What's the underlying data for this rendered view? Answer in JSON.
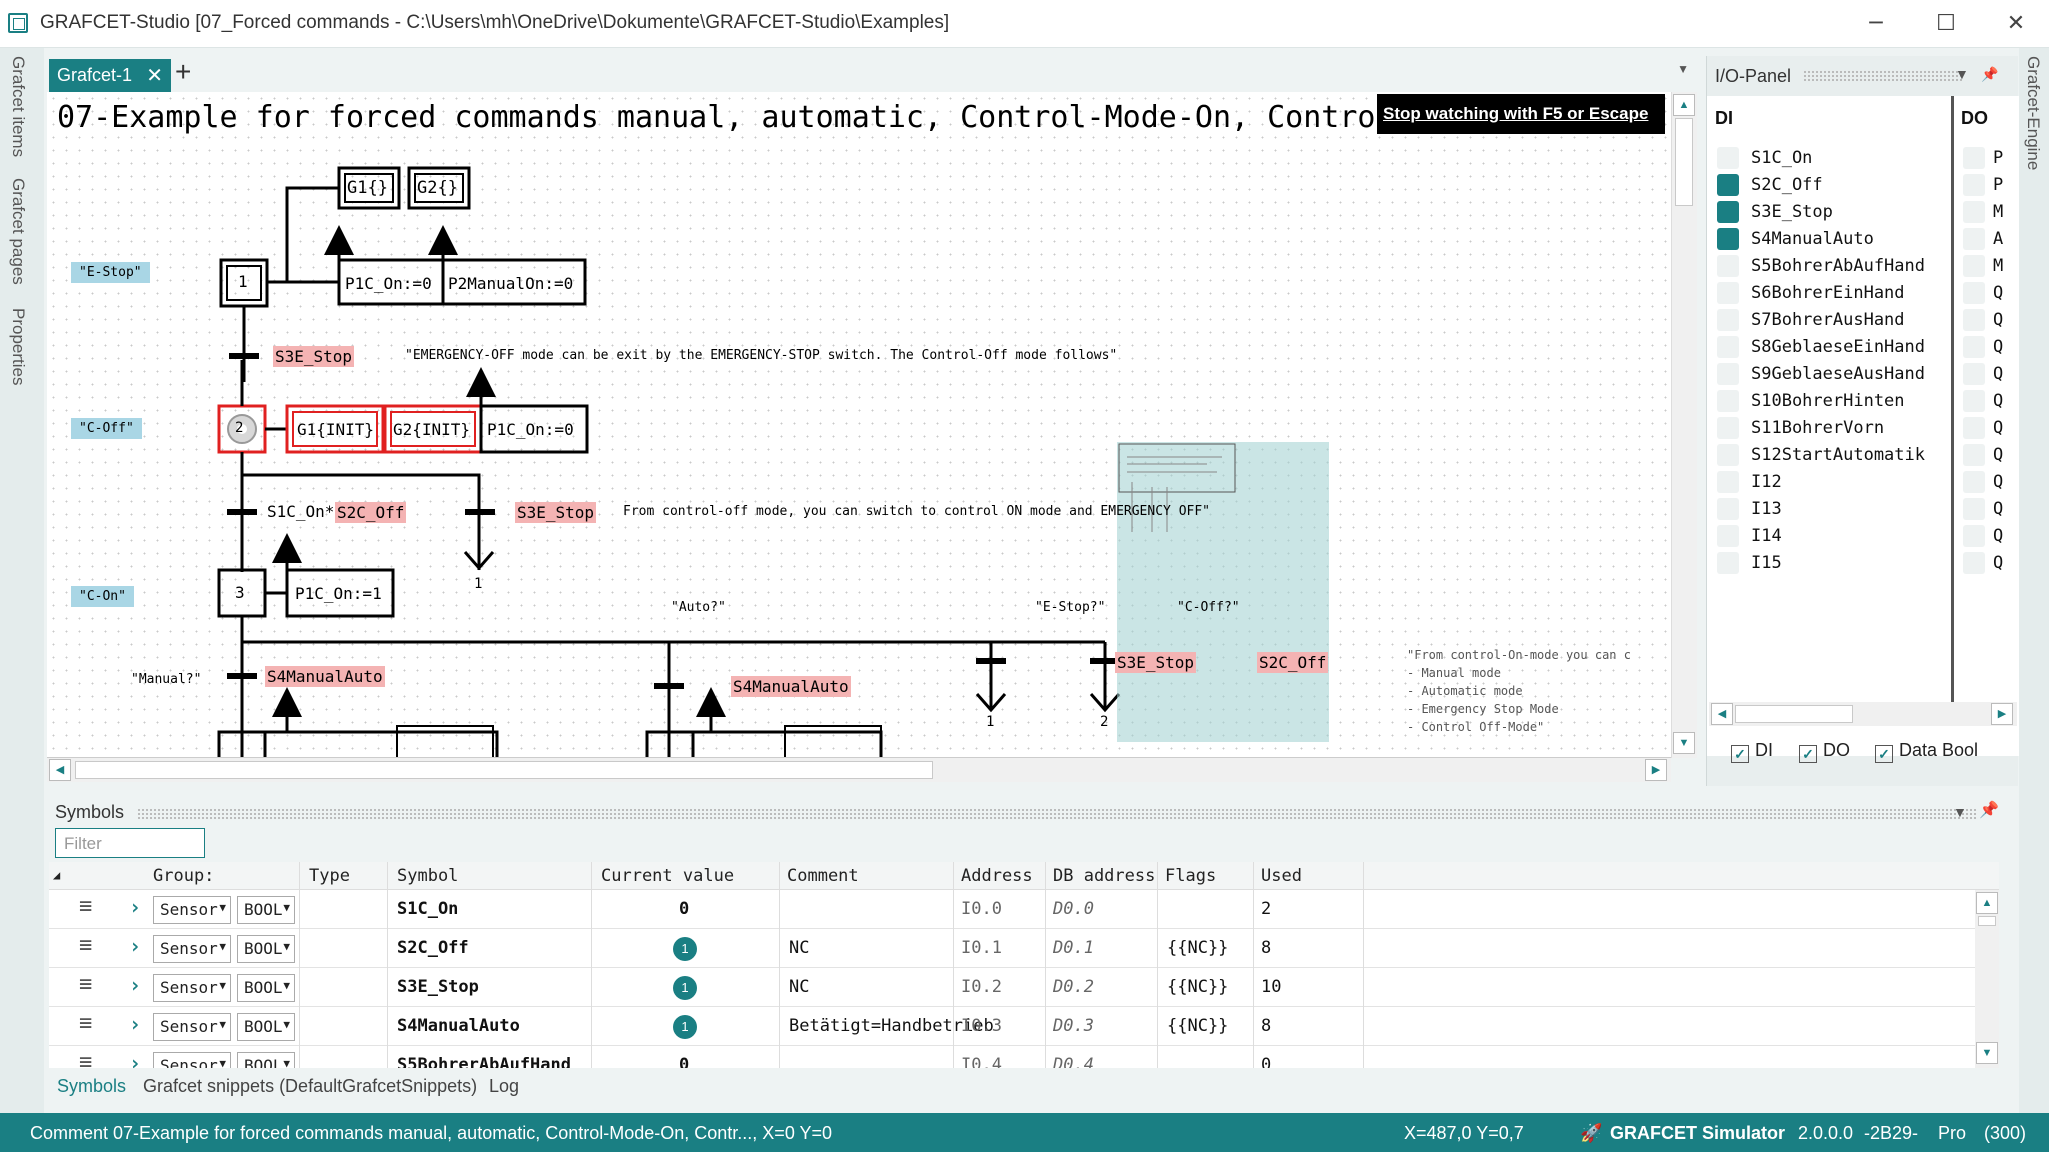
{
  "window": {
    "title": "GRAFCET-Studio [07_Forced commands - C:\\Users\\mh\\OneDrive\\Dokumente\\GRAFCET-Studio\\Examples]",
    "minimize": "─",
    "maximize": "☐",
    "close": "✕"
  },
  "left_strip": {
    "tabs": [
      "Grafcet items",
      "Grafcet pages",
      "Properties"
    ]
  },
  "right_strip": {
    "tabs": [
      "Grafcet-Engine"
    ]
  },
  "doc": {
    "tab_label": "Grafcet-1",
    "tab_close": "✕",
    "add_tab": "+",
    "heading": "07-Example for forced commands manual, automatic, Control-Mode-On, Contro",
    "overlay": "Stop watching with F5 or Escape",
    "grafcet": {
      "forced_top": [
        "G1{}",
        "G2{}"
      ],
      "action1": [
        "P1C_On:=0",
        "P2ManualOn:=0"
      ],
      "forced_step2": [
        "G1{INIT}",
        "G2{INIT}"
      ],
      "action2": "P1C_On:=0",
      "action3": "P1C_On:=1",
      "comments": [
        "\"E-Stop\"",
        "\"C-Off\"",
        "\"C-On\"",
        "\"Manual?\"",
        "\"Auto?\"",
        "\"E-Stop?\"",
        "\"C-Off?\""
      ],
      "steps": [
        "1",
        "2",
        "3"
      ],
      "transitions": {
        "t1": "S3E_Stop",
        "t2a_prefix": "S1C_On*",
        "t2a_var": "S2C_Off",
        "t2b": "S3E_Stop",
        "t3a": "S4ManualAuto",
        "t3b": "S4ManualAuto",
        "t3c": "S3E_Stop",
        "t3d": "S2C_Off"
      },
      "note1": "\"EMERGENCY-OFF mode can be exit by the EMERGENCY-STOP switch. The Control-Off mode follows\"",
      "note2": "From control-off mode, you can switch to control ON mode and EMERGENCY OFF\"",
      "jumps": [
        "1",
        "1",
        "2"
      ],
      "side_note": [
        "\"From control-On-mode you can c",
        "- Manual mode",
        "- Automatic mode",
        "- Emergency Stop Mode",
        "- Control Off-Mode\""
      ]
    }
  },
  "io_panel": {
    "title": "I/O-Panel",
    "pin": "📌",
    "di_header": "DI",
    "do_header": "DO",
    "di": [
      {
        "name": "S1C_On",
        "on": false
      },
      {
        "name": "S2C_Off",
        "on": true
      },
      {
        "name": "S3E_Stop",
        "on": true
      },
      {
        "name": "S4ManualAuto",
        "on": true
      },
      {
        "name": "S5BohrerAbAufHand",
        "on": false
      },
      {
        "name": "S6BohrerEinHand",
        "on": false
      },
      {
        "name": "S7BohrerAusHand",
        "on": false
      },
      {
        "name": "S8GeblaeseEinHand",
        "on": false
      },
      {
        "name": "S9GeblaeseAusHand",
        "on": false
      },
      {
        "name": "S10BohrerHinten",
        "on": false
      },
      {
        "name": "S11BohrerVorn",
        "on": false
      },
      {
        "name": "S12StartAutomatik",
        "on": false
      },
      {
        "name": "I12",
        "on": false
      },
      {
        "name": "I13",
        "on": false
      },
      {
        "name": "I14",
        "on": false
      },
      {
        "name": "I15",
        "on": false
      }
    ],
    "do_initials": [
      "P",
      "P",
      "M",
      "A",
      "M",
      "Q",
      "Q",
      "Q",
      "Q",
      "Q",
      "Q",
      "Q",
      "Q",
      "Q",
      "Q",
      "Q"
    ],
    "filters": [
      "DI",
      "DO",
      "Data Bool"
    ],
    "check": "✓"
  },
  "symbols": {
    "title": "Symbols",
    "filter_placeholder": "Filter",
    "columns": [
      "Group:",
      "Type",
      "Symbol",
      "Current value",
      "Comment",
      "Address",
      "DB address",
      "Flags",
      "Used"
    ],
    "rows": [
      {
        "group": "Sensor",
        "type": "BOOL",
        "symbol": "S1C_On",
        "value": "0",
        "active": false,
        "comment": "",
        "address": "I0.0",
        "db": "D0.0",
        "flags": "",
        "used": "2"
      },
      {
        "group": "Sensor",
        "type": "BOOL",
        "symbol": "S2C_Off",
        "value": "1",
        "active": true,
        "comment": "NC",
        "address": "I0.1",
        "db": "D0.1",
        "flags": "{{NC}}",
        "used": "8"
      },
      {
        "group": "Sensor",
        "type": "BOOL",
        "symbol": "S3E_Stop",
        "value": "1",
        "active": true,
        "comment": "NC",
        "address": "I0.2",
        "db": "D0.2",
        "flags": "{{NC}}",
        "used": "10"
      },
      {
        "group": "Sensor",
        "type": "BOOL",
        "symbol": "S4ManualAuto",
        "value": "1",
        "active": true,
        "comment": "Betätigt=Handbetrieb",
        "address": "I0.3",
        "db": "D0.3",
        "flags": "{{NC}}",
        "used": "8"
      },
      {
        "group": "Sensor",
        "type": "BOOL",
        "symbol": "S5BohrerAbAufHand",
        "value": "0",
        "active": false,
        "comment": "",
        "address": "I0.4",
        "db": "D0.4",
        "flags": "",
        "used": "0"
      }
    ]
  },
  "bottom_tabs": [
    "Symbols",
    "Grafcet snippets (DefaultGrafcetSnippets)",
    "Log"
  ],
  "status": {
    "comment": "Comment 07-Example for forced commands manual, automatic, Control-Mode-On, Contr..., X=0 Y=0",
    "coords": "X=487,0  Y=0,7",
    "app": "GRAFCET Simulator",
    "version": "2.0.0.0",
    "build": "-2B29-",
    "edition": "Pro",
    "count": "(300)"
  },
  "colors": {
    "accent": "#1a7f83",
    "highlight_var": "#f4b3b3",
    "forced_red": "#e02020",
    "comment_bg": "#a9d6e5"
  }
}
